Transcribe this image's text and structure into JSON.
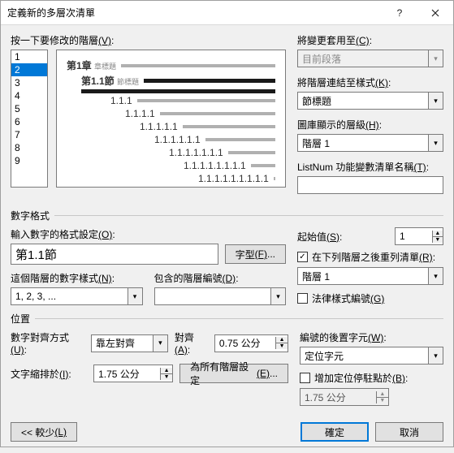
{
  "titlebar": {
    "title": "定義新的多層次清單"
  },
  "top": {
    "level_label_pre": "按一下要修改的階層",
    "level_label_key": "(V)",
    "levels": [
      "1",
      "2",
      "3",
      "4",
      "5",
      "6",
      "7",
      "8",
      "9"
    ],
    "selected_level_index": 1,
    "apply_label_pre": "將變更套用至",
    "apply_label_key": "(C)",
    "apply_value": "目前段落",
    "link_label_pre": "將階層連結至樣式",
    "link_label_key": "(K)",
    "link_value": "節標題",
    "gallery_label_pre": "圖庫顯示的層級",
    "gallery_label_key": "(H)",
    "gallery_value": "階層 1",
    "listnum_label_pre": "ListNum 功能變數清單名稱",
    "listnum_label_key": "(T)",
    "listnum_value": ""
  },
  "preview": {
    "r1_text": "第1章",
    "r1_sub": "章標題",
    "r2_text": "第1.1節",
    "r2_sub": "節標題",
    "rows": [
      "1.1.1",
      "1.1.1.1",
      "1.1.1.1.1",
      "1.1.1.1.1.1",
      "1.1.1.1.1.1.1",
      "1.1.1.1.1.1.1.1",
      "1.1.1.1.1.1.1.1.1"
    ]
  },
  "numfmt": {
    "group": "數字格式",
    "enter_label_pre": "輸入數字的格式設定",
    "enter_label_key": "(O)",
    "enter_value": "第1.1節",
    "font_btn_pre": "字型",
    "font_btn_key": "(F)",
    "style_label_pre": "這個階層的數字樣式",
    "style_label_key": "(N)",
    "style_value": "1, 2, 3, ...",
    "include_label_pre": "包含的階層編號",
    "include_label_key": "(D)",
    "include_value": "",
    "start_label_pre": "起始值",
    "start_label_key": "(S)",
    "start_value": "1",
    "restart_label_pre": "在下列階層之後重列清單",
    "restart_label_key": "(R)",
    "restart_checked": true,
    "restart_value": "階層 1",
    "legal_label_pre": "法律樣式編號",
    "legal_label_key": "(G)",
    "legal_checked": false
  },
  "pos": {
    "group": "位置",
    "align_label_pre": "數字對齊方式",
    "align_label_key": "(U)",
    "align_value": "靠左對齊",
    "alignat_label_pre": "對齊",
    "alignat_label_key": "(A)",
    "alignat_value": "0.75 公分",
    "indent_label_pre": "文字縮排於",
    "indent_label_key": "(I)",
    "indent_value": "1.75 公分",
    "setall_btn_pre": "為所有階層設定",
    "setall_btn_key": "(E)",
    "follow_label_pre": "編號的後置字元",
    "follow_label_key": "(W)",
    "follow_value": "定位字元",
    "tabstop_label_pre": "增加定位停駐點於",
    "tabstop_label_key": "(B)",
    "tabstop_checked": false,
    "tabstop_value": "1.75 公分"
  },
  "footer": {
    "less_pre": "<< 較少",
    "less_key": "(L)",
    "ok": "確定",
    "cancel": "取消"
  }
}
